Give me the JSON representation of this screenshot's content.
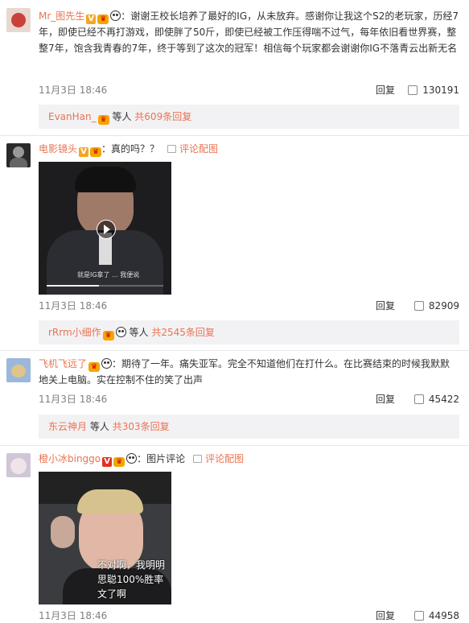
{
  "comments": [
    {
      "user": "Mr_图先生",
      "text": "：谢谢王校长培养了最好的IG，从未放弃。感谢你让我这个S2的老玩家，历经7年，即使已经不再打游戏，即使胖了50斤，即使已经被工作压得喘不过气，每年依旧看世界赛，整整7年，饱含我青春的7年，终于等到了这次的冠军！相信每个玩家都会谢谢你IG不落青云出新无名",
      "time": "11月3日 18:46",
      "reply_label": "回复",
      "likes": "130191",
      "reply_preview": {
        "names": "EvanHan_",
        "suffix": "等人",
        "count_label": "共609条回复"
      }
    },
    {
      "user": "电影镜头",
      "text": "：真的吗？？",
      "comment_pic_label": "评论配图",
      "time": "11月3日 18:46",
      "reply_label": "回复",
      "likes": "82909",
      "video_caption": "就是IG拿了 ... 我便说",
      "reply_preview": {
        "names": "rRrm小细作",
        "suffix": "等人",
        "count_label": "共2545条回复"
      }
    },
    {
      "user": "飞机飞远了",
      "text": "：期待了一年。痛失亚军。完全不知道他们在打什么。在比赛结束的时候我默默地关上电脑。实在控制不住的笑了出声",
      "time": "11月3日 18:46",
      "reply_label": "回复",
      "likes": "45422",
      "reply_preview": {
        "names": "东云神月",
        "suffix": "等人",
        "count_label": "共303条回复"
      }
    },
    {
      "user": "橙小冰binggo",
      "text": "：图片评论",
      "comment_pic_label": "评论配图",
      "time": "11月3日 18:46",
      "reply_label": "回复",
      "likes": "44958",
      "meme_caption_1": "不对啊，我明明",
      "meme_caption_2": "思聪100%胜率",
      "meme_caption_3": "文了啊"
    }
  ]
}
